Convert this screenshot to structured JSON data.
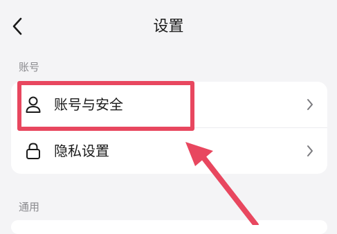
{
  "header": {
    "title": "设置",
    "back_icon": "chevron-left-icon"
  },
  "sections": [
    {
      "label": "账号",
      "items": [
        {
          "label": "账号与安全",
          "icon": "user-icon",
          "trailing_icon": "chevron-right-icon"
        },
        {
          "label": "隐私设置",
          "icon": "lock-icon",
          "trailing_icon": "chevron-right-icon"
        }
      ]
    },
    {
      "label": "通用",
      "items": []
    }
  ],
  "annotation": {
    "color": "#e8475f",
    "highlight": "账号与安全"
  }
}
